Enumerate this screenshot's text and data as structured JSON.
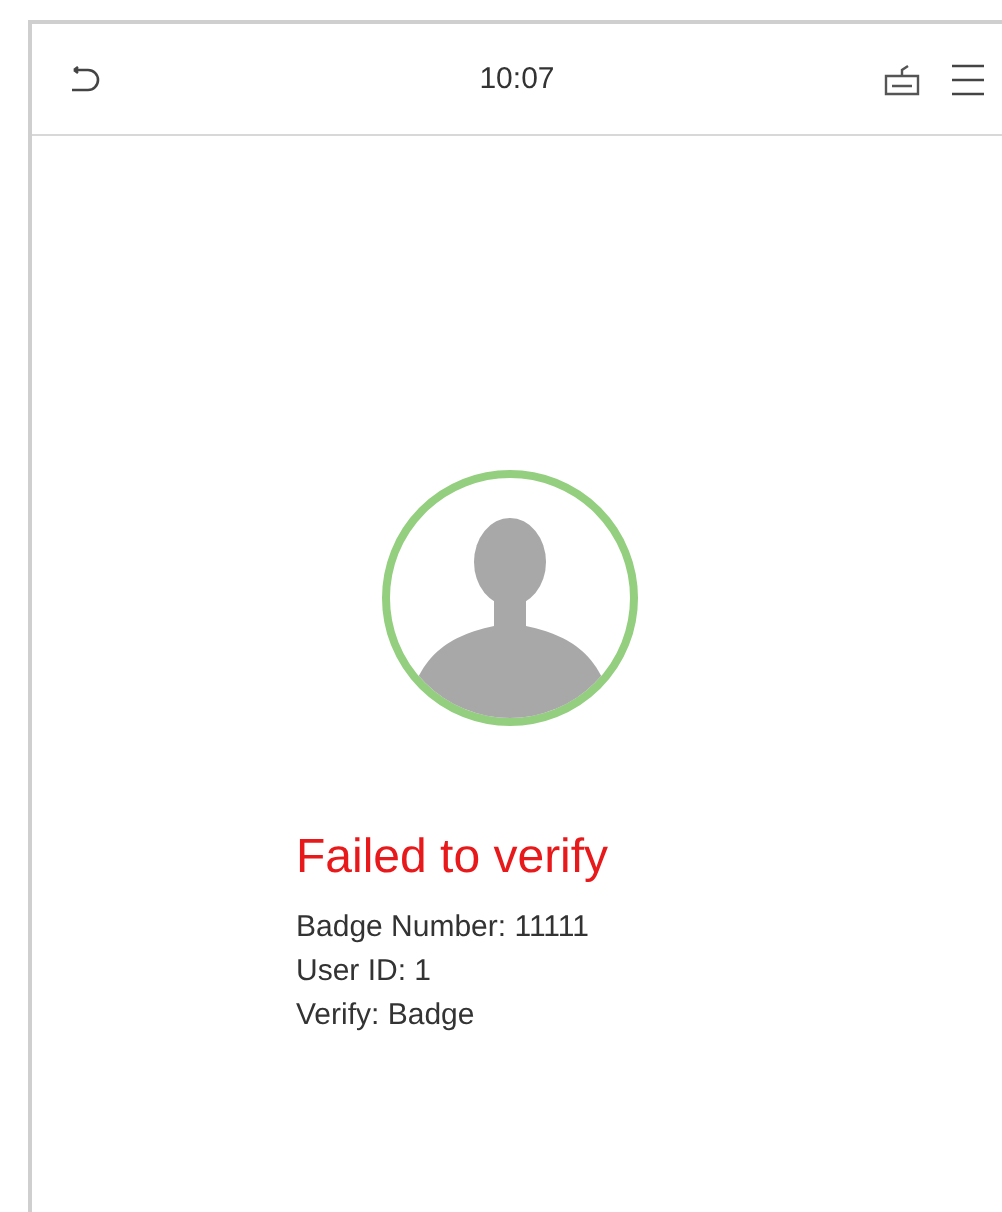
{
  "header": {
    "time": "10:07"
  },
  "result": {
    "status": "Failed to verify",
    "details": [
      "Badge Number: 11111",
      "User ID: 1",
      "Verify: Badge"
    ]
  }
}
